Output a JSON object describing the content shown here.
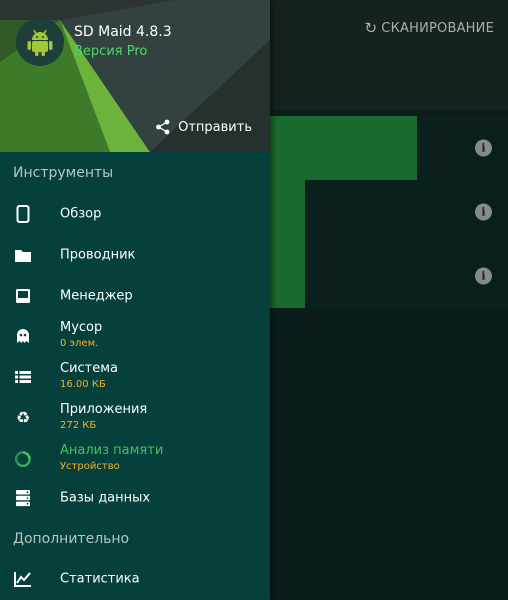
{
  "toolbar": {
    "scan_label": "СКАНИРОВАНИЕ"
  },
  "storage_rows": [
    {
      "fill_fraction": 0.82
    },
    {
      "fill_fraction": 0.6
    },
    {
      "fill_fraction": 0.6
    }
  ],
  "drawer": {
    "app_name": "SD Maid 4.8.3",
    "edition": "Версия Pro",
    "share_label": "Отправить",
    "tools_title": "Инструменты",
    "extra_title": "Дополнительно",
    "items": [
      {
        "label": "Обзор",
        "icon": "phone-icon"
      },
      {
        "label": "Проводник",
        "icon": "folder-icon"
      },
      {
        "label": "Менеджер",
        "icon": "manager-icon"
      },
      {
        "label": "Мусор",
        "sub": "0 элем.",
        "icon": "ghost-icon"
      },
      {
        "label": "Система",
        "sub": "16.00 КБ",
        "icon": "list-icon"
      },
      {
        "label": "Приложения",
        "sub": "272 КБ",
        "icon": "recycle-icon"
      },
      {
        "label": "Анализ памяти",
        "sub": "Устройство",
        "icon": "storage-analyzer-icon",
        "active": true
      },
      {
        "label": "Базы данных",
        "icon": "database-icon"
      },
      {
        "label": "Статистика",
        "icon": "chart-icon"
      }
    ]
  },
  "colors": {
    "drawer_bg": "#06403d",
    "accent_green": "#3fc45c",
    "edition_green": "#4cd964",
    "subtitle_orange": "#f3b128",
    "bar_green": "#1a6a2e"
  }
}
